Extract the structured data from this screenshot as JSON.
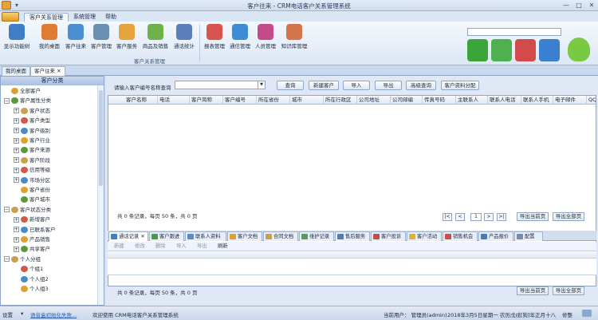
{
  "window": {
    "title": "客户往来 - CRM电话客户关系管理系统",
    "controls": [
      "—",
      "□",
      "✕"
    ]
  },
  "ribbon_tabs": [
    "客户关系管理",
    "系统管理",
    "帮助"
  ],
  "ribbon": {
    "buttons": [
      {
        "label": "显示功能树",
        "color": "#3e7ec9"
      },
      {
        "label": "我的桌面",
        "color": "#e07b31"
      },
      {
        "label": "客户往来",
        "color": "#4a8fd1"
      },
      {
        "label": "客户管理",
        "color": "#6b8fb0"
      },
      {
        "label": "客户服务",
        "color": "#e5a53a"
      },
      {
        "label": "商品及销售",
        "color": "#6fb24a"
      },
      {
        "label": "通话统计",
        "color": "#5b7fb8"
      },
      {
        "label": "报表管理",
        "color": "#d9534f"
      },
      {
        "label": "通信管理",
        "color": "#3b8ed6"
      },
      {
        "label": "人员管理",
        "color": "#c44a8c"
      },
      {
        "label": "知识库管理",
        "color": "#d4744a"
      }
    ],
    "group_label": "客户关系管理"
  },
  "doc_tabs": [
    "我的桌面",
    "客户往来"
  ],
  "tree": {
    "title": "客户分类",
    "nodes": [
      {
        "label": "全部客户",
        "level": 0,
        "exp": ""
      },
      {
        "label": "客户属性分类",
        "level": 0,
        "exp": "−"
      },
      {
        "label": "客户状态",
        "level": 1,
        "exp": "+"
      },
      {
        "label": "客户类型",
        "level": 1,
        "exp": "+"
      },
      {
        "label": "客户级别",
        "level": 1,
        "exp": "+"
      },
      {
        "label": "客户行业",
        "level": 1,
        "exp": "+"
      },
      {
        "label": "客户来源",
        "level": 1,
        "exp": "+"
      },
      {
        "label": "客户阶段",
        "level": 1,
        "exp": "+"
      },
      {
        "label": "信用等级",
        "level": 1,
        "exp": "+"
      },
      {
        "label": "市场分区",
        "level": 1,
        "exp": "+"
      },
      {
        "label": "客户省份",
        "level": 1,
        "exp": ""
      },
      {
        "label": "客户城市",
        "level": 1,
        "exp": ""
      },
      {
        "label": "客户状态分类",
        "level": 0,
        "exp": "−"
      },
      {
        "label": "新增客户",
        "level": 1,
        "exp": "+"
      },
      {
        "label": "已联系客户",
        "level": 1,
        "exp": "+"
      },
      {
        "label": "产品销售",
        "level": 1,
        "exp": "+"
      },
      {
        "label": "共享客户",
        "level": 1,
        "exp": "+"
      },
      {
        "label": "个人分组",
        "level": 0,
        "exp": "−"
      },
      {
        "label": "个组1",
        "level": 1,
        "exp": ""
      },
      {
        "label": "个人组2",
        "level": 1,
        "exp": ""
      },
      {
        "label": "个人组3",
        "level": 1,
        "exp": ""
      }
    ]
  },
  "search": {
    "label": "请输入客户编号名称查询",
    "value": ""
  },
  "toolbar": [
    "查询",
    "新建客户",
    "导入",
    "导出",
    "高级查询",
    "客户资料分配"
  ],
  "grid": {
    "columns": [
      "客户名称",
      "电话",
      "客户简称",
      "客户编号",
      "所在省份",
      "城市",
      "所在行政区",
      "公司地址",
      "公司邮编",
      "传真号码",
      "主联系人",
      "联系人电话",
      "联系人手机",
      "电子邮件",
      "QQ"
    ]
  },
  "paging": {
    "summary": "共 0 条记录，每页 50 条，共 0 页",
    "first": "|<",
    "prev": "<",
    "page": "1",
    "next": ">",
    "last": ">|",
    "export_page": "导出当前页",
    "export_all": "导出全部页"
  },
  "sub_tabs": [
    {
      "label": "通话记录",
      "color": "#3b7fc4"
    },
    {
      "label": "客户跟进",
      "color": "#4a9a4a"
    },
    {
      "label": "联系人资料",
      "color": "#5a8ac8"
    },
    {
      "label": "客户文档",
      "color": "#e0a030"
    },
    {
      "label": "合同文档",
      "color": "#c8a050"
    },
    {
      "label": "维护记录",
      "color": "#5a9a5a"
    },
    {
      "label": "售后服务",
      "color": "#5a7aa8"
    },
    {
      "label": "客户投诉",
      "color": "#c84a4a"
    },
    {
      "label": "客户活动",
      "color": "#e0b040"
    },
    {
      "label": "销售机会",
      "color": "#d04a4a"
    },
    {
      "label": "产品报价",
      "color": "#4a7ab8"
    },
    {
      "label": "配置",
      "color": "#7a8aa8"
    }
  ],
  "sub_toolbar": [
    "新建",
    "修改",
    "删除",
    "导入",
    "导出",
    "刷新"
  ],
  "sub_paging": {
    "summary": "共 0 条记录，每页 50 条，共 0 页",
    "export_page": "导出当前页",
    "export_all": "导出全部页"
  },
  "status": {
    "setting": "设置",
    "message_link": "语音盒初始化失败...",
    "welcome": "欢迎使用 CRM电话客户关系管理系统",
    "user": "当前用户： 管理员(admin)",
    "date": "2018年3月5日星期一 农历戊戌[狗]年正月十八",
    "status_label": "修整"
  }
}
